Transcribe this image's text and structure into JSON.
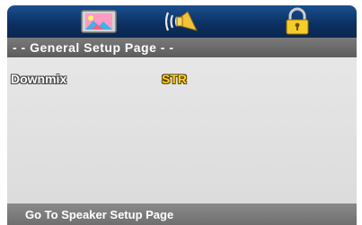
{
  "tabs": [
    {
      "icon": "picture-icon"
    },
    {
      "icon": "speaker-icon"
    },
    {
      "icon": "lock-icon"
    }
  ],
  "title": "- - General Setup Page - -",
  "settings": [
    {
      "label": "Downmix",
      "value": "STR"
    }
  ],
  "status": "Go To Speaker Setup Page",
  "colors": {
    "tab_bar": "#0c2f61",
    "title_bar": "#6b6b6b",
    "content_bg": "#e1e1e1",
    "value_yellow": "#ffd21f"
  }
}
